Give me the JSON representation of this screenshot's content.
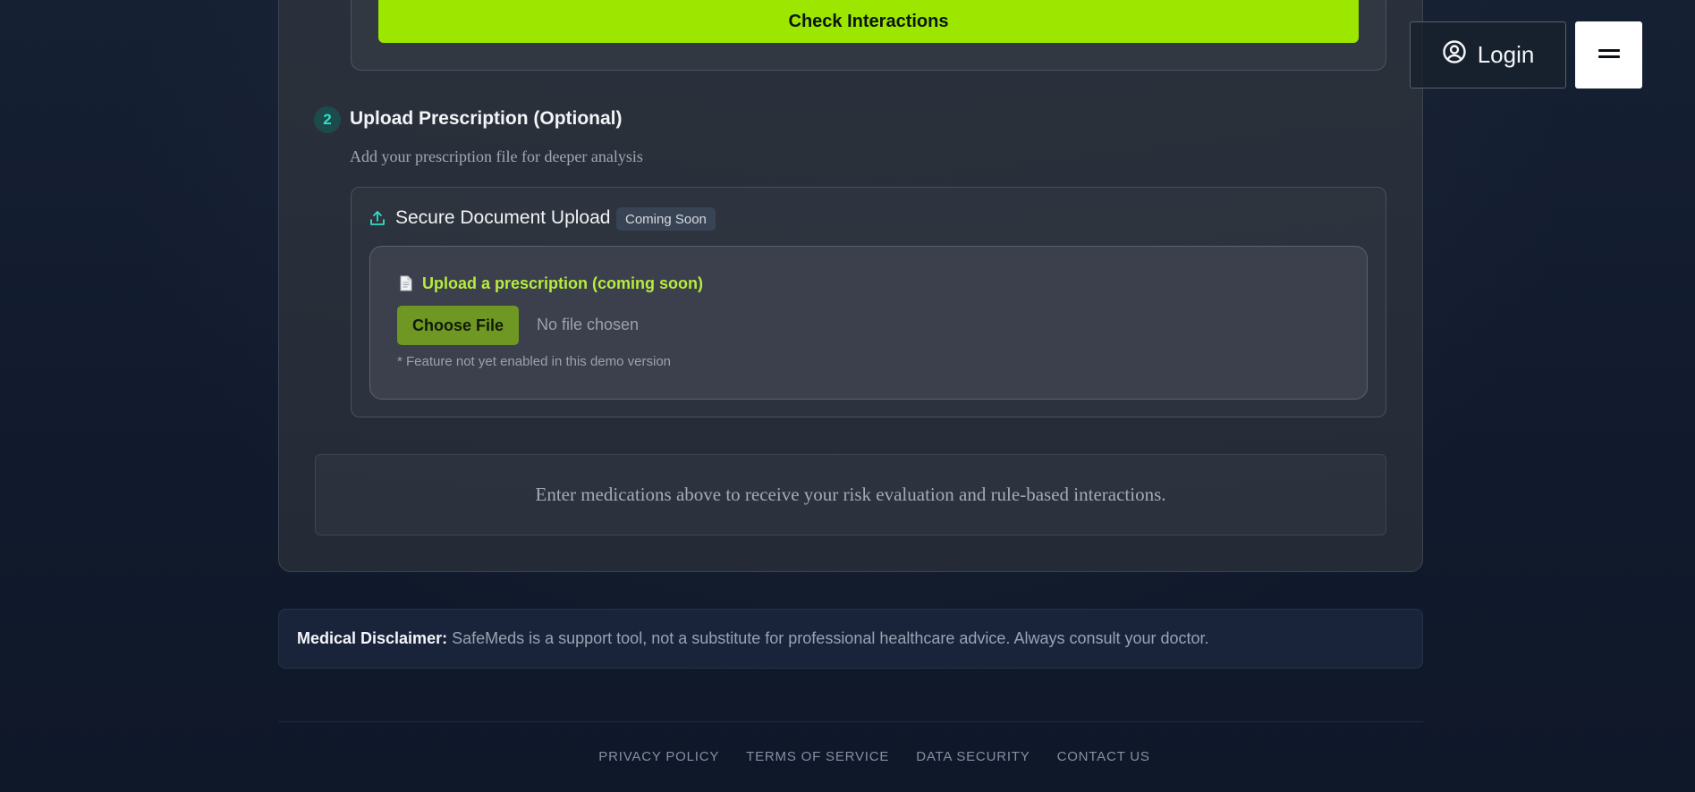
{
  "interactions": {
    "check_label": "Check Interactions"
  },
  "step2": {
    "number": "2",
    "title": "Upload Prescription (Optional)",
    "subtitle": "Add your prescription file for deeper analysis"
  },
  "upload": {
    "title": "Secure Document Upload",
    "badge": "Coming Soon",
    "link_label": "Upload a prescription (coming soon)",
    "choose_label": "Choose File",
    "file_status": "No file chosen",
    "note": "* Feature not yet enabled in this demo version"
  },
  "info": {
    "message": "Enter medications above to receive your risk evaluation and rule-based interactions."
  },
  "disclaimer": {
    "label": "Medical Disclaimer:",
    "text": "SafeMeds is a support tool, not a substitute for professional healthcare advice. Always consult your doctor."
  },
  "footer": {
    "links": [
      "PRIVACY POLICY",
      "TERMS OF SERVICE",
      "DATA SECURITY",
      "CONTACT US"
    ]
  },
  "header": {
    "login_label": "Login"
  },
  "icons": {
    "upload": "upload-icon",
    "document": "document-icon",
    "user": "user-circle-icon",
    "menu": "menu-icon"
  },
  "colors": {
    "accent": "#9ce600",
    "teal": "#2ee0c8",
    "link_green": "#b7ec3a",
    "choose_button": "#6e9724"
  }
}
